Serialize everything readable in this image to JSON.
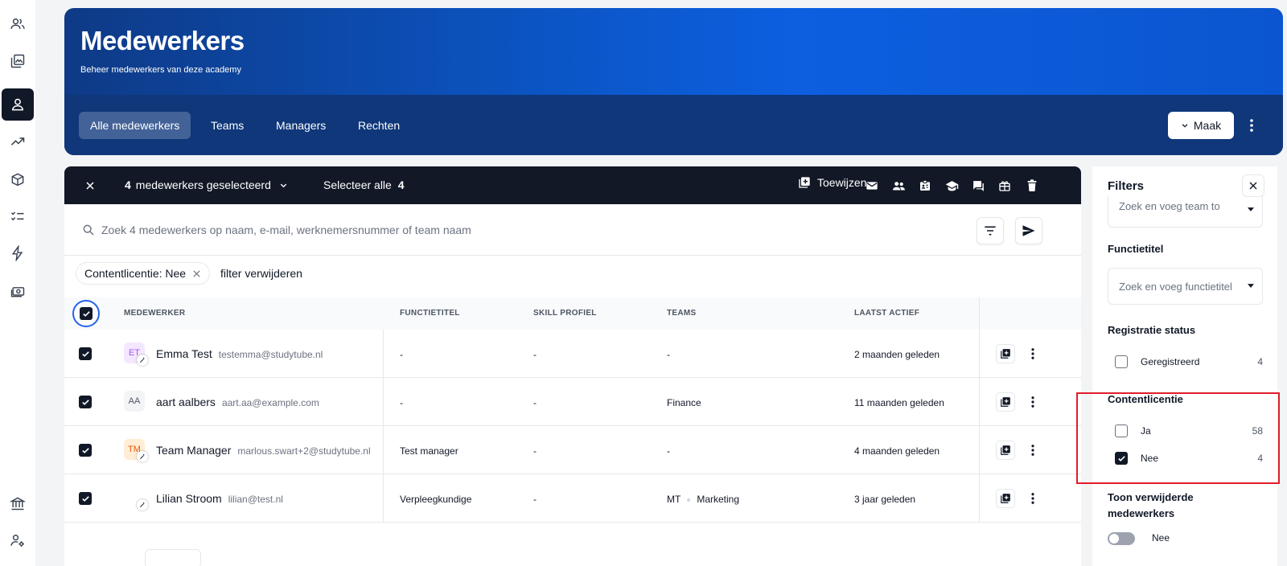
{
  "header": {
    "title": "Medewerkers",
    "subtitle": "Beheer medewerkers van deze academy",
    "tabs": [
      "Alle medewerkers",
      "Teams",
      "Managers",
      "Rechten"
    ],
    "make_label": "Maak"
  },
  "selection": {
    "count": "4",
    "count_label": "medewerkers geselecteerd",
    "select_all_label": "Selecteer alle",
    "select_all_count": "4",
    "assign_label": "Toewijzen"
  },
  "search": {
    "placeholder": "Zoek 4 medewerkers op naam, e-mail, werknemersnummer of team naam"
  },
  "active_filter": {
    "chip_label": "Contentlicentie: Nee",
    "remove_label": "filter verwijderen"
  },
  "table": {
    "columns": [
      "MEDEWERKER",
      "FUNCTIETITEL",
      "SKILL PROFIEL",
      "TEAMS",
      "LAATST ACTIEF"
    ],
    "rows": [
      {
        "initials": "ET",
        "name": "Emma Test",
        "email": "testemma@studytube.nl",
        "functie": "-",
        "skill": "-",
        "team1": "-",
        "team2": "",
        "laatst": "2 maanden geleden"
      },
      {
        "initials": "AA",
        "name": "aart aalbers",
        "email": "aart.aa@example.com",
        "functie": "-",
        "skill": "-",
        "team1": "Finance",
        "team2": "",
        "laatst": "11 maanden geleden"
      },
      {
        "initials": "TM",
        "name": "Team Manager",
        "email": "marlous.swart+2@studytube.nl",
        "functie": "Test manager",
        "skill": "-",
        "team1": "-",
        "team2": "",
        "laatst": "4 maanden geleden"
      },
      {
        "initials": "",
        "name": "Lilian Stroom",
        "email": "lilian@test.nl",
        "functie": "Verpleegkundige",
        "skill": "-",
        "team1": "MT",
        "team2": "Marketing",
        "laatst": "3 jaar geleden"
      }
    ]
  },
  "filters": {
    "title": "Filters",
    "team_placeholder": "Zoek en voeg team to",
    "functietitel_label": "Functietitel",
    "functietitel_placeholder": "Zoek en voeg functietitel",
    "registratie_label": "Registratie status",
    "registratie_options": [
      {
        "label": "Geregistreerd",
        "count": "4",
        "checked": false
      }
    ],
    "contentlicentie_label": "Contentlicentie",
    "contentlicentie_options": [
      {
        "label": "Ja",
        "count": "58",
        "checked": false
      },
      {
        "label": "Nee",
        "count": "4",
        "checked": true
      }
    ],
    "deleted_label_line1": "Toon verwijderde",
    "deleted_label_line2": "medewerkers",
    "deleted_toggle_label": "Nee"
  },
  "colors": {
    "header_gradient_start": "#0e3a86",
    "header_gradient_end": "#0d5fe0",
    "selection_bar": "#121826",
    "highlight": "#e11d2a"
  }
}
